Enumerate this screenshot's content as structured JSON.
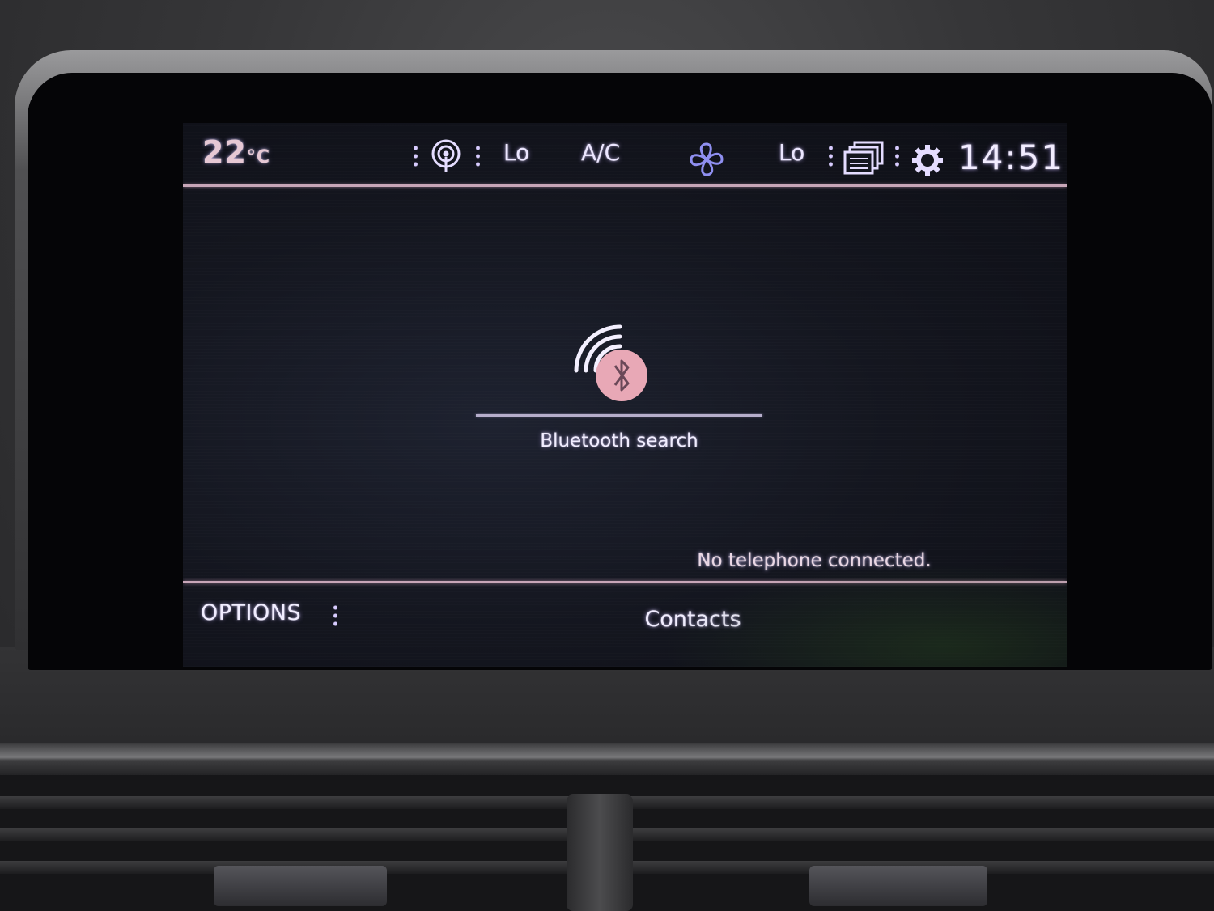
{
  "top_bar": {
    "temperature_value": "22",
    "temperature_unit": "°C",
    "fan_left_level": "Lo",
    "ac_label": "A/C",
    "fan_right_level": "Lo",
    "clock": "14:51"
  },
  "main": {
    "bluetooth_search_label": "Bluetooth search",
    "status_message": "No telephone connected."
  },
  "bottom_bar": {
    "options_label": "OPTIONS",
    "contacts_label": "Contacts"
  },
  "icons": {
    "top_bar": [
      "air-recirculation-icon",
      "fan-icon",
      "windows-icon",
      "gear-icon"
    ],
    "main": [
      "bluetooth-search-icon"
    ]
  },
  "colors": {
    "text": "#f1edff",
    "accent_divider": "#c8a6b8",
    "temperature_text": "#e6c8d4",
    "bluetooth_circle": "#e8a8b6",
    "fan_icon": "#8f8ff0"
  }
}
